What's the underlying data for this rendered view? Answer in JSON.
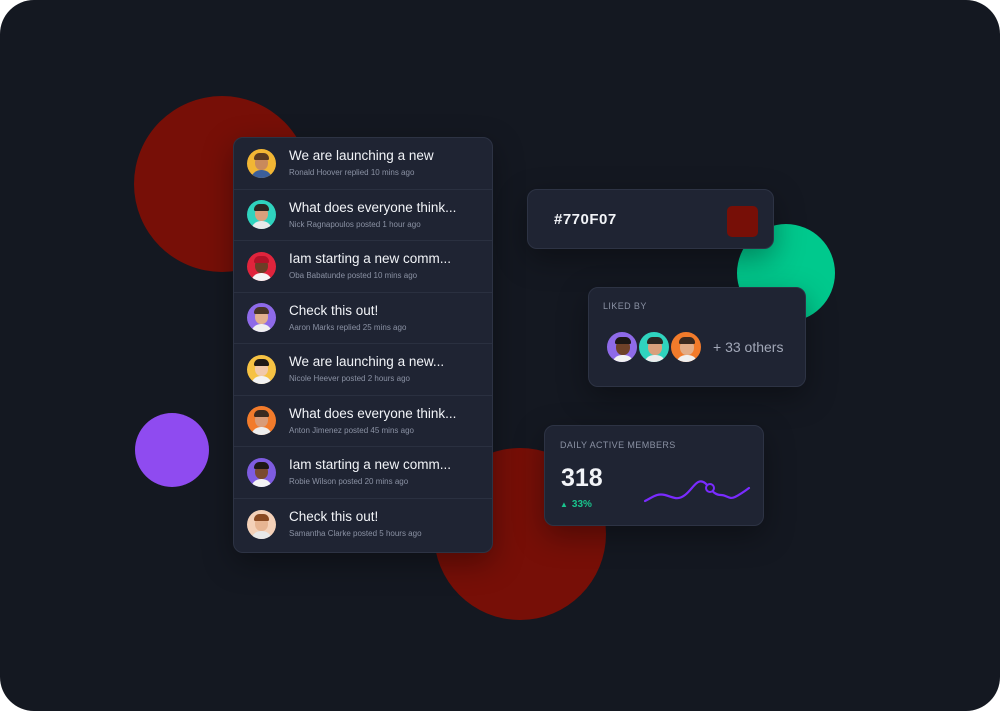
{
  "colors": {
    "accent": "#770F07",
    "positive": "#19c48d",
    "blob_green": "#00c98d",
    "background": "#141821",
    "card": "#1f2433"
  },
  "feed": {
    "items": [
      {
        "title": "We are launching a new",
        "subtitle": "Ronald Hoover replied 10 mins ago",
        "avatar_icon": "user-avatar-icon"
      },
      {
        "title": "What does everyone think...",
        "subtitle": "Nick Ragnapoulos posted 1 hour ago",
        "avatar_icon": "user-avatar-icon"
      },
      {
        "title": "Iam starting a new comm...",
        "subtitle": "Oba Babatunde posted 10 mins ago",
        "avatar_icon": "user-avatar-icon"
      },
      {
        "title": "Check this out!",
        "subtitle": "Aaron Marks replied 25 mins ago",
        "avatar_icon": "user-avatar-icon"
      },
      {
        "title": "We are launching a new...",
        "subtitle": "Nicole Heever posted 2 hours ago",
        "avatar_icon": "user-avatar-icon"
      },
      {
        "title": "What does everyone think...",
        "subtitle": "Anton Jimenez posted 45 mins ago",
        "avatar_icon": "user-avatar-icon"
      },
      {
        "title": "Iam starting a new comm...",
        "subtitle": "Robie Wilson posted 20 mins ago",
        "avatar_icon": "user-avatar-icon"
      },
      {
        "title": "Check this out!",
        "subtitle": "Samantha Clarke posted 5 hours ago",
        "avatar_icon": "user-avatar-icon"
      }
    ]
  },
  "color_card": {
    "hex": "#770F07"
  },
  "liked_by": {
    "label": "LIKED BY",
    "others": "+ 33 others"
  },
  "daily_active": {
    "label": "DAILY ACTIVE MEMBERS",
    "value": "318",
    "change": "33%",
    "change_icon": "triangle-up-icon"
  }
}
